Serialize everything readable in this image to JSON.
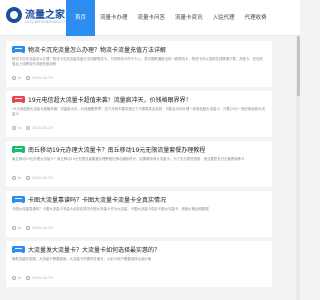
{
  "header": {
    "logo_text": "流量之家",
    "logo_sub": "LLZJ.WEIXINZHIJIA.COM",
    "nav": [
      {
        "label": "首页",
        "active": true
      },
      {
        "label": "流量卡办理",
        "active": false
      },
      {
        "label": "流量卡问答",
        "active": false
      },
      {
        "label": "流量卡资讯",
        "active": false
      },
      {
        "label": "入驻代理",
        "active": false
      },
      {
        "label": "代理收费",
        "active": false
      }
    ]
  },
  "articles": [
    {
      "tag_color": "blue",
      "title": "物流卡沉充流量怎么办理？物流卡流量充值方法详解",
      "summary": "物流卡沉充流量怎么办理？物流卡沉充流量充值方法详解物流卡，又称物流卡的卡卡入，是中国联通推出的一款物流卡，物流卡可以选择在线联通下载、资费卡、在线充值及上线等操作详细充值流程",
      "author": "llz",
      "date": "2025-02-25"
    },
    {
      "tag_color": "red",
      "title": "19元电信超大流量卡超值来袭！流量疯冲天，价钱格眼界界！",
      "summary": "19元电信超大流量卡超值来袭！流量疯冲天，价钱格眼界界！这个月就不要将错过了不要着急会找到，可能会为你办理一张电信超大流量卡，只要19元一张的电信超大流量卡",
      "author": "llz",
      "date": "2025-02-25"
    },
    {
      "tag_color": "green",
      "title": "南丘移动19元办理大流量卡？南丘移动19元无限流量套餐办理教程",
      "summary": "南丘移动19元办理大流量卡？南丘移动19元无限流量套餐办理教程在移动通信时代，如果要申请大流量卡，为了支付更低资费，而且要是支付无套餐特殊卡",
      "author": "llz",
      "date": "2025-02-25"
    },
    {
      "tag_color": "blue",
      "title": "卡图大流量靠谱吗？卡图大流量卡流量卡全真实情况",
      "summary": "卡图大流量靠谱吗？卡图大流量卡流量卡全真实情况卡图大流量卡作为大流量，卡图大流量卡真实卡图大流量卡，资费价格全网数据",
      "author": "llz",
      "date": "2025-02-25"
    },
    {
      "tag_color": "blue",
      "title": "大流量发大流量卡？大流量卡如何选择最实惠的？",
      "summary": "随着流量的发展，大流量卡需要使用，大流量卡的需求在增长，以前卡用户需要选择合适价格",
      "author": "llz",
      "date": "2025-02-25"
    }
  ],
  "colors": {
    "accent": "#2d8cf0",
    "tag_blue": "#2d8cf0",
    "tag_red": "#e5484d",
    "tag_green": "#19be6b",
    "logo": "#1e4f9f"
  }
}
